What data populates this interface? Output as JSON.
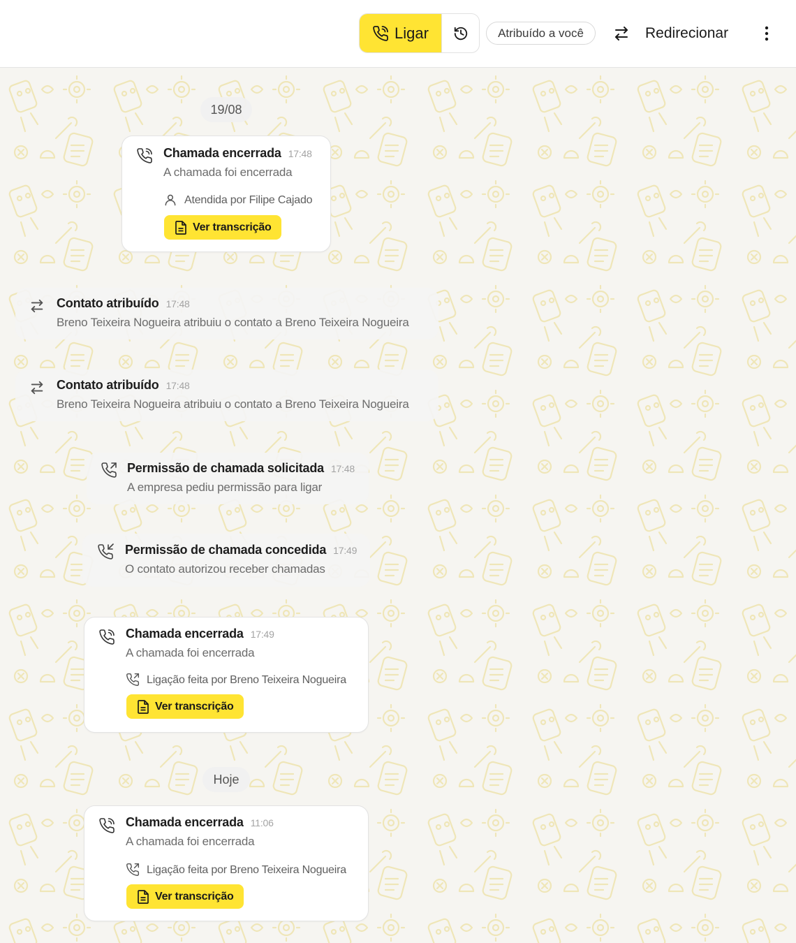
{
  "header": {
    "call_label": "Ligar",
    "assigned_label": "Atribuído a você",
    "redirect_label": "Redirecionar"
  },
  "dates": {
    "first": "19/08",
    "today": "Hoje"
  },
  "events": [
    {
      "title": "Chamada encerrada",
      "time": "17:48",
      "subtitle": "A chamada foi encerrada",
      "meta": "Atendida por Filipe Cajado",
      "button": "Ver transcrição"
    },
    {
      "title": "Contato atribuído",
      "time": "17:48",
      "subtitle": "Breno Teixeira Nogueira atribuiu o contato a Breno Teixeira Nogueira"
    },
    {
      "title": "Contato atribuído",
      "time": "17:48",
      "subtitle": "Breno Teixeira Nogueira atribuiu o contato a Breno Teixeira Nogueira"
    },
    {
      "title": "Permissão de chamada solicitada",
      "time": "17:48",
      "subtitle": "A empresa pediu permissão para ligar"
    },
    {
      "title": "Permissão de chamada concedida",
      "time": "17:49",
      "subtitle": "O contato autorizou receber chamadas"
    },
    {
      "title": "Chamada encerrada",
      "time": "17:49",
      "subtitle": "A chamada foi encerrada",
      "meta": "Ligação feita por Breno Teixeira Nogueira",
      "button": "Ver transcrição"
    },
    {
      "title": "Chamada encerrada",
      "time": "11:06",
      "subtitle": "A chamada foi encerrada",
      "meta": "Ligação feita por Breno Teixeira Nogueira",
      "button": "Ver transcrição"
    }
  ],
  "colors": {
    "accent": "#ffe433",
    "pattern": "#efe6b8"
  }
}
